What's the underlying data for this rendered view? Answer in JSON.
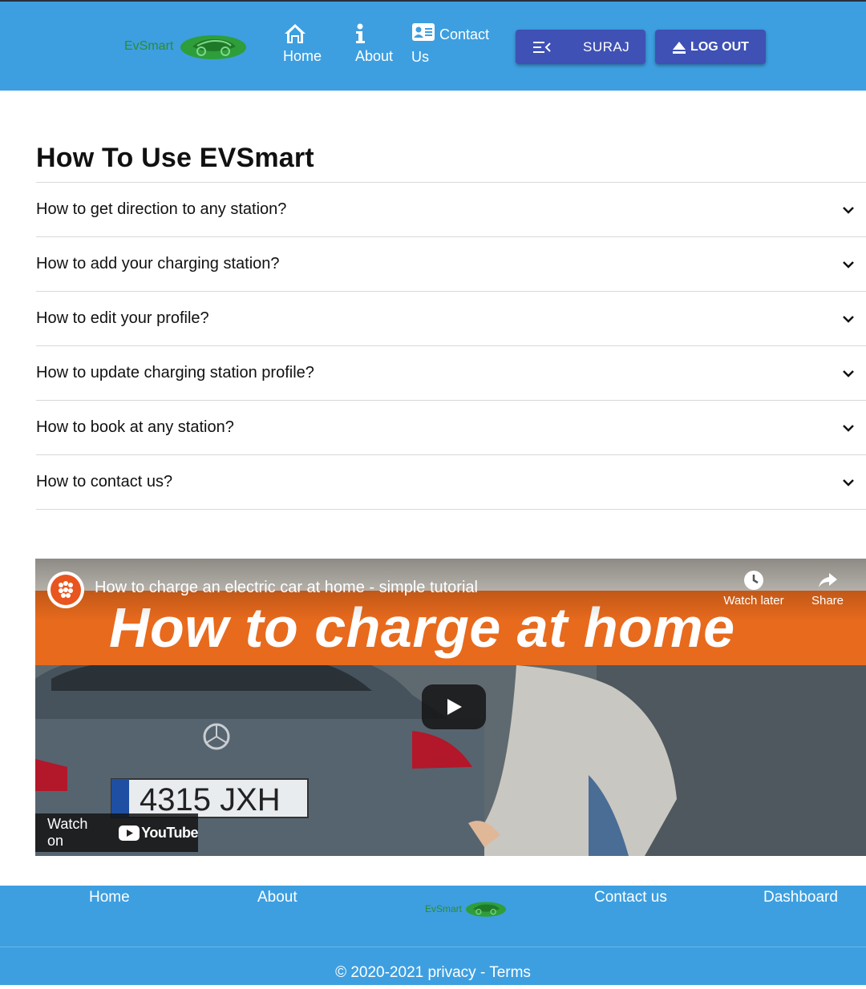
{
  "header": {
    "logo_text": "EvSmart",
    "nav": {
      "home": "Home",
      "about": "About",
      "contact_line1": "Contact",
      "contact_line2": "Us"
    },
    "user_button": "SURAJ",
    "logout_button": "LOG OUT"
  },
  "main": {
    "title": "How To Use EVSmart",
    "faq": [
      "How to get direction to any station?",
      "How to add your charging station?",
      "How to edit your profile?",
      "How to update charging station profile?",
      "How to book at any station?",
      "How to contact us?"
    ]
  },
  "video": {
    "title": "How to charge an electric car at home - simple tutorial",
    "headline": "How to charge at home",
    "watch_later": "Watch later",
    "share": "Share",
    "watch_on": "Watch on",
    "youtube": "YouTube"
  },
  "footer": {
    "home": "Home",
    "about": "About",
    "logo_text": "EvSmart",
    "contact": "Contact us",
    "dashboard": "Dashboard",
    "copyright": "© 2020-2021 privacy - Terms"
  },
  "colors": {
    "header_bg": "#3d9fe0",
    "button_bg": "#3f51b5",
    "logo_green": "#2e8b2e",
    "video_band": "#e86a1d"
  }
}
